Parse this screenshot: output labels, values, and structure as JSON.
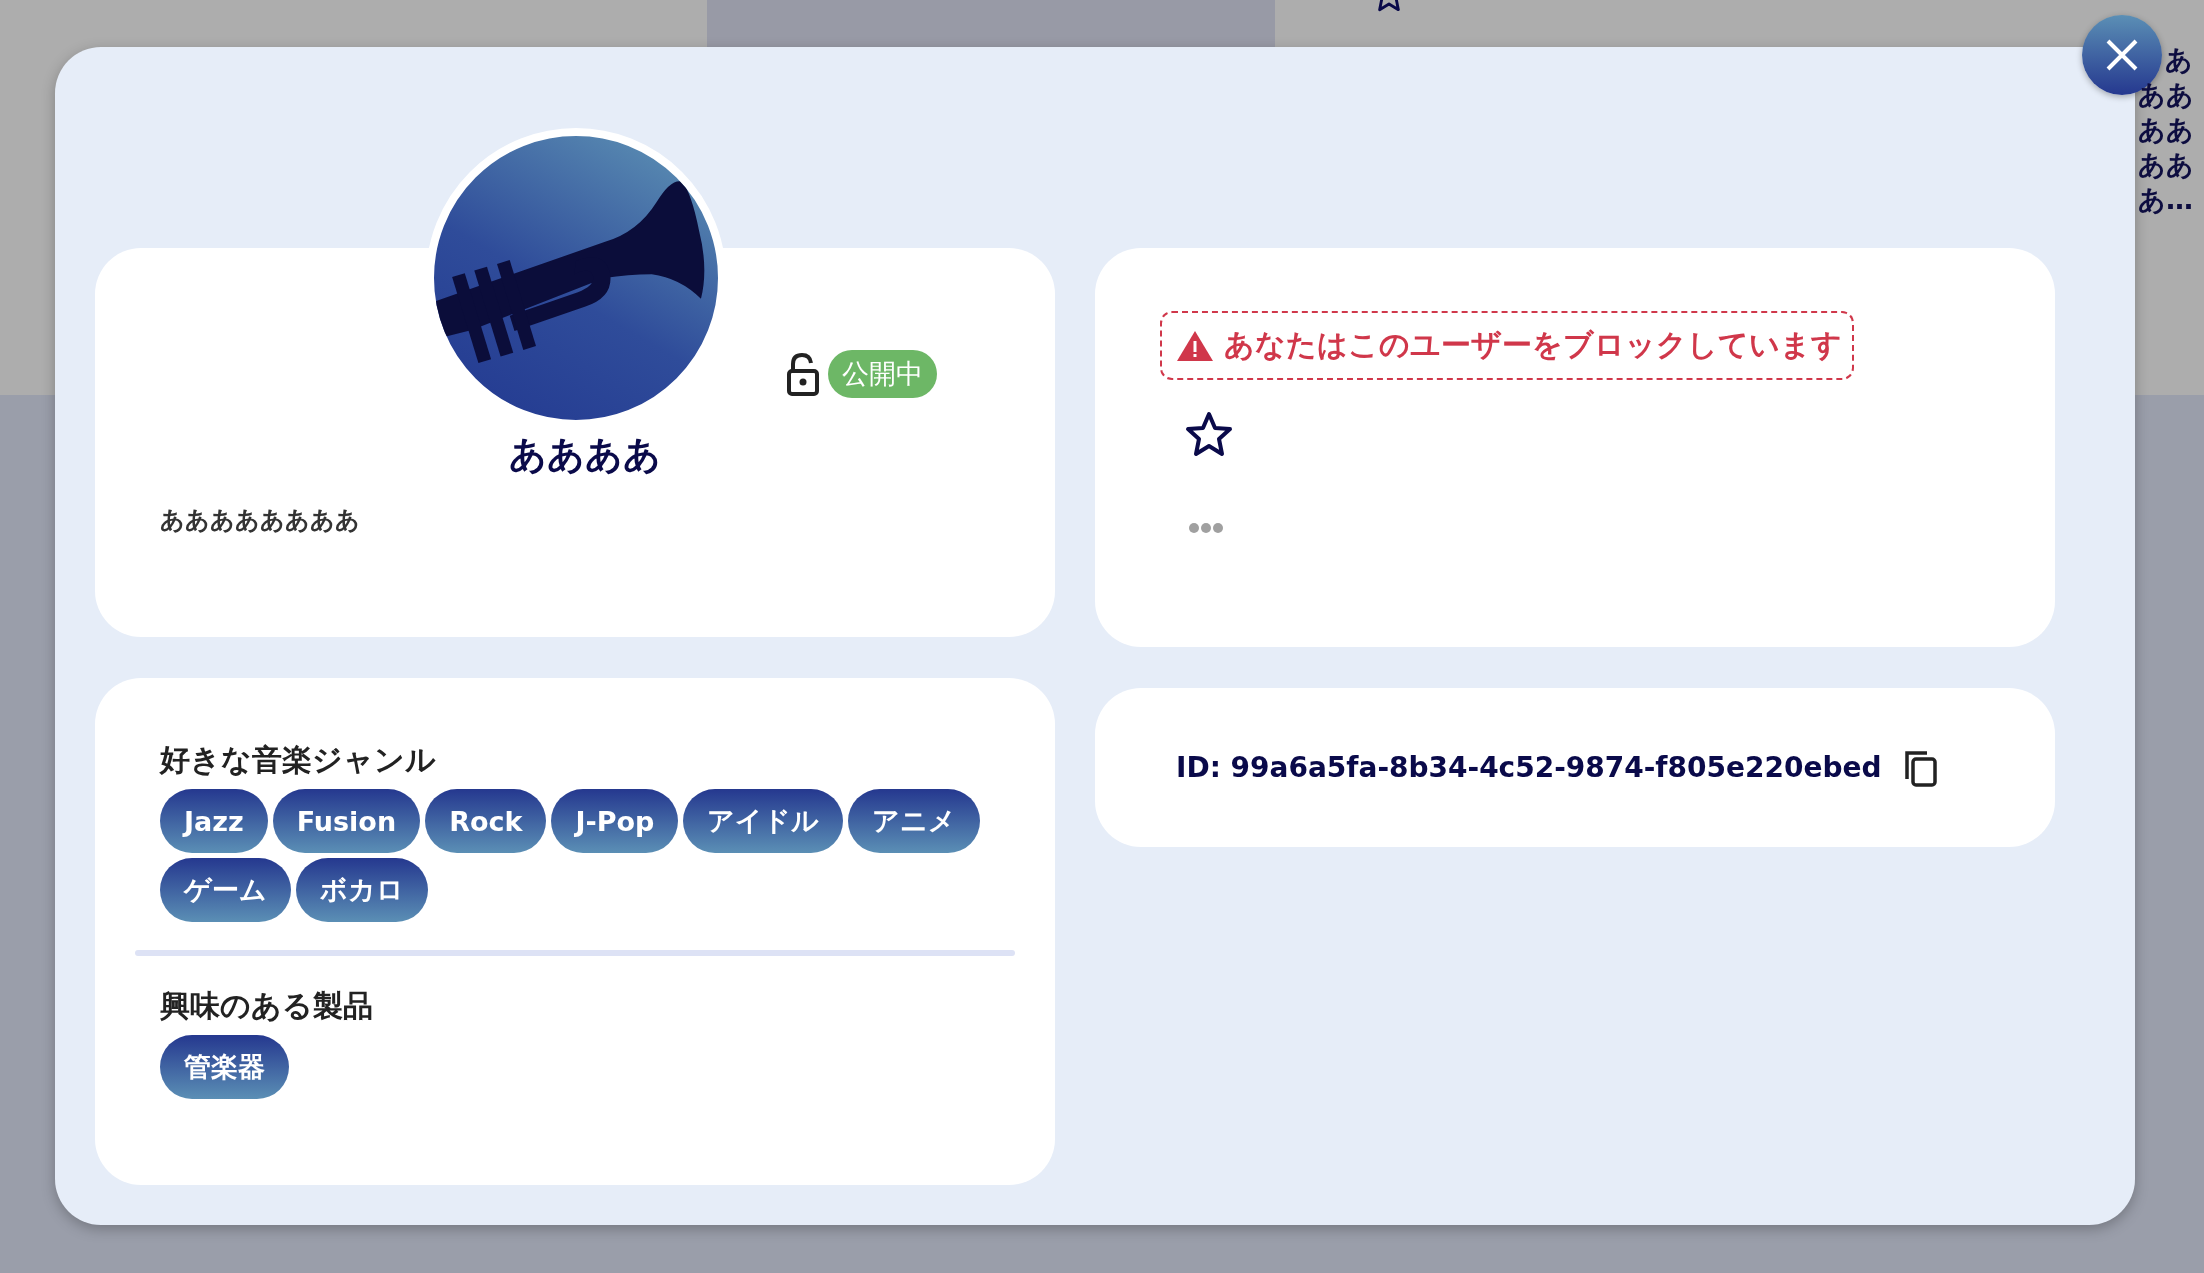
{
  "background": {
    "side_text": "ああああああああ…"
  },
  "profile": {
    "name": "ああああ",
    "bio": "ああああああああ",
    "visibility": {
      "public": true,
      "label": "公開中"
    }
  },
  "status": {
    "block_notice": "あなたはこのユーザーをブロックしています",
    "favorited": false
  },
  "sections": [
    {
      "title": "好きな音楽ジャンル",
      "tags": [
        "Jazz",
        "Fusion",
        "Rock",
        "J-Pop",
        "アイドル",
        "アニメ",
        "ゲーム",
        "ボカロ"
      ]
    },
    {
      "title": "興味のある製品",
      "tags": [
        "管楽器"
      ]
    }
  ],
  "user_id": "ID: 99a6a5fa-8b34-4c52-9874-f805e220ebed"
}
